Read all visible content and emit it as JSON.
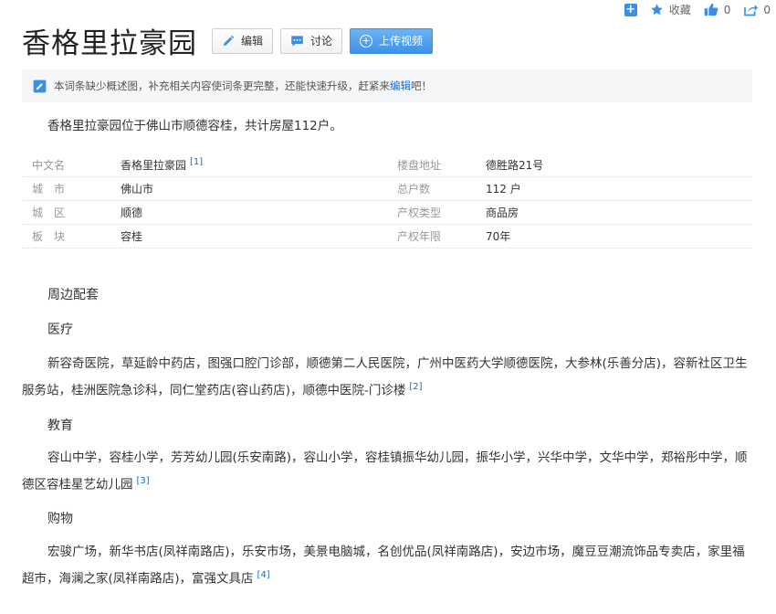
{
  "toolbar": {
    "collect_label": "收藏",
    "like_count": "0",
    "share_count": "0"
  },
  "title": "香格里拉豪园",
  "buttons": {
    "edit": "编辑",
    "discuss": "讨论",
    "upload": "上传视频"
  },
  "notice": {
    "text": "本词条缺少概述图，补充相关内容使词条更完整，还能快速升级，赶紧来",
    "link": "编辑",
    "tail": "吧！"
  },
  "summary": "香格里拉豪园位于佛山市顺德容桂，共计房屋112户。",
  "info": {
    "left": [
      {
        "key": "中文名",
        "value": "香格里拉豪园",
        "ref": "[1]"
      },
      {
        "key": "城　市",
        "value": "佛山市",
        "ref": ""
      },
      {
        "key": "城　区",
        "value": "顺德",
        "ref": ""
      },
      {
        "key": "板　块",
        "value": "容桂",
        "ref": ""
      }
    ],
    "right": [
      {
        "key": "楼盘地址",
        "value": "德胜路21号"
      },
      {
        "key": "总户数",
        "value": "112 户"
      },
      {
        "key": "产权类型",
        "value": "商品房"
      },
      {
        "key": "产权年限",
        "value": "70年"
      }
    ]
  },
  "sections": {
    "surroundings": "周边配套",
    "medical_title": "医疗",
    "medical_text": "新容奇医院，草延龄中药店，图强口腔门诊部，顺德第二人民医院，广州中医药大学顺德医院，大参林(乐善分店)，容新社区卫生服务站，桂洲医院急诊科，同仁堂药店(容山药店)，顺德中医院-门诊楼",
    "medical_ref": "[2]",
    "education_title": "教育",
    "education_text": "容山中学，容桂小学，芳芳幼儿园(乐安南路)，容山小学，容桂镇振华幼儿园，振华小学，兴华中学，文华中学，郑裕彤中学，顺德区容桂星艺幼儿园",
    "education_ref": "[3]",
    "shopping_title": "购物",
    "shopping_text": "宏骏广场，新华书店(凤祥南路店)，乐安市场，美景电脑城，名创优品(凤祥南路店)，安边市场，魔豆豆潮流饰品专卖店，家里福超市，海澜之家(凤祥南路店)，富强文具店",
    "shopping_ref": "[4]"
  }
}
